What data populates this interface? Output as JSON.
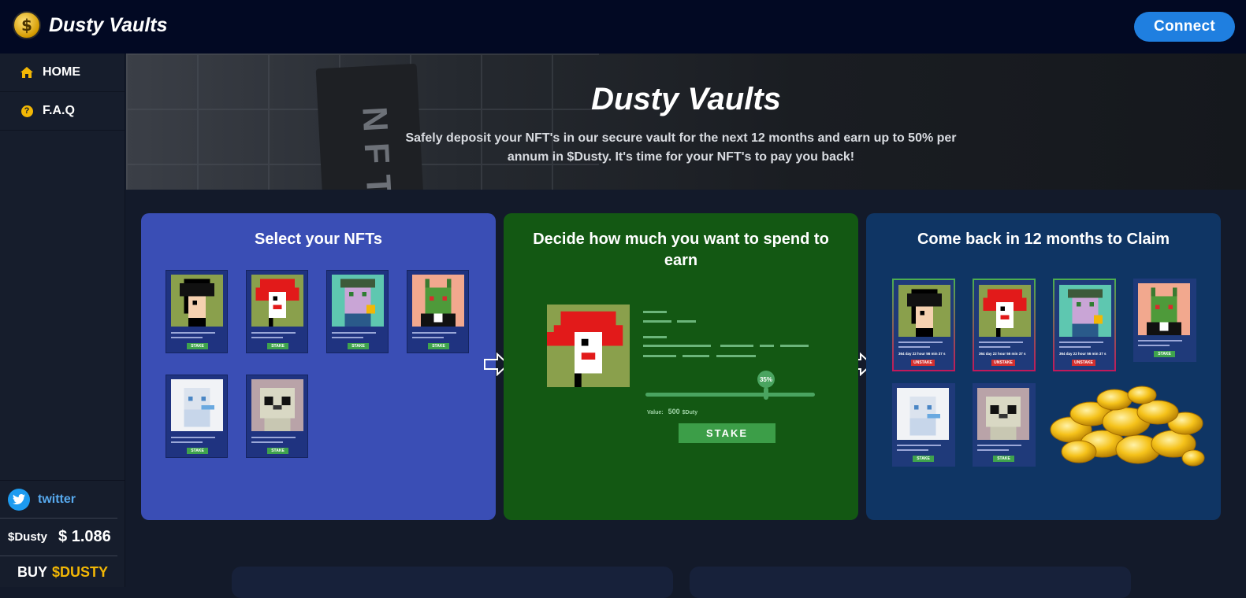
{
  "app": {
    "name": "Dusty Vaults",
    "logo_glyph": "$"
  },
  "header": {
    "connect_label": "Connect"
  },
  "sidebar": {
    "items": [
      {
        "label": "HOME",
        "icon": "home-icon"
      },
      {
        "label": "F.A.Q",
        "icon": "question-circle-icon",
        "glyph": "?"
      }
    ],
    "twitter_label": "twitter",
    "token_name": "$Dusty",
    "token_price": "$ 1.086",
    "buy_prefix": "BUY",
    "buy_token": "$DUSTY"
  },
  "hero": {
    "title": "Dusty Vaults",
    "subtitle": "Safely deposit your NFT's in our secure vault for the next 12 months and earn up to 50% per annum in $Dusty. It's time for your NFT's to pay you back!",
    "tag_text": "NFT"
  },
  "steps": {
    "select": {
      "title": "Select your NFTs",
      "stake_label": "STAKE"
    },
    "decide": {
      "title": "Decide how much you want to spend to earn",
      "slider_percent": "35%",
      "value_label": "Value:",
      "value_amount": "500",
      "value_unit": "$Duty",
      "stake_label": "STAKE"
    },
    "claim": {
      "title": "Come back in 12 months to Claim",
      "timer_text": "364 day 22 hour 56 min 37 s",
      "unstake_label": "UNSTAKE",
      "stake_label": "STAKE"
    }
  },
  "colors": {
    "accent": "#f2b705",
    "connect": "#1f7fe0",
    "card_select": "#3a4eb5",
    "card_decide": "#135813",
    "card_claim": "#0f3564"
  }
}
